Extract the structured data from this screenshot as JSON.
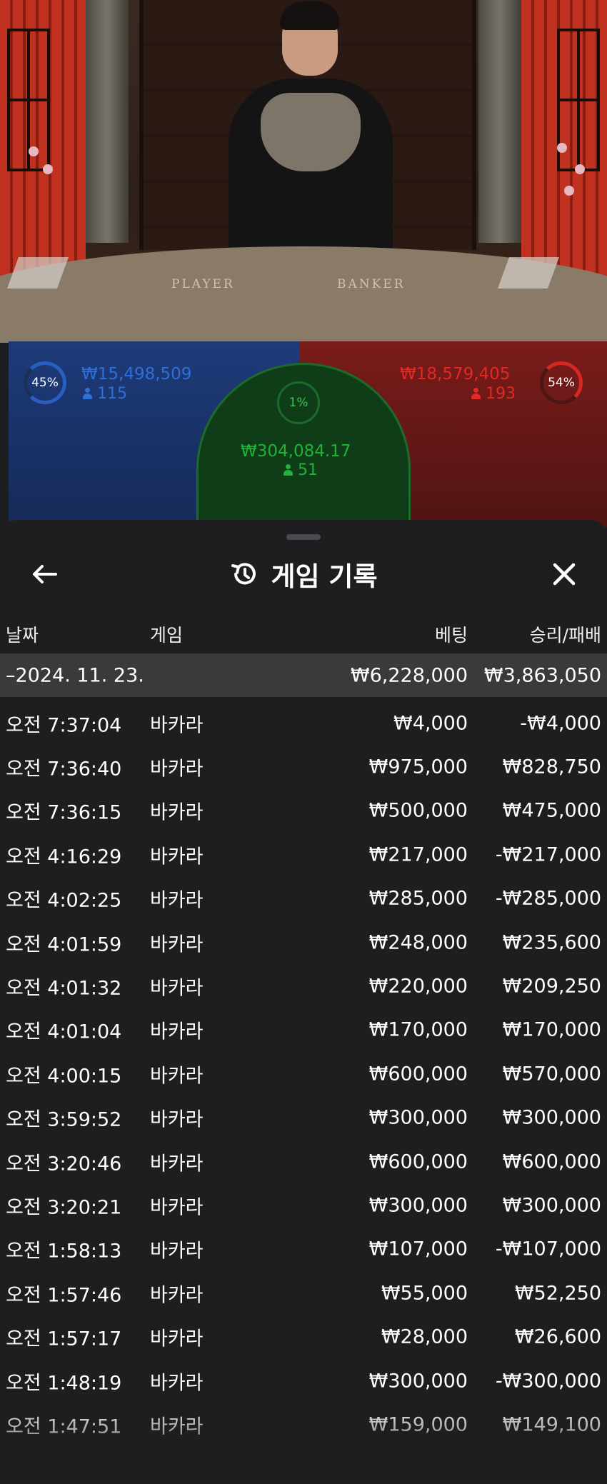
{
  "video": {
    "table_labels": {
      "player": "PLAYER",
      "banker": "BANKER"
    }
  },
  "bets": {
    "player": {
      "percent": "45%",
      "amount": "₩15,498,509",
      "count": "115",
      "color": "#2e6fd8"
    },
    "tie": {
      "percent": "1%",
      "amount": "₩304,084.17",
      "count": "51",
      "color": "#1fb33a"
    },
    "banker": {
      "percent": "54%",
      "amount": "₩18,579,405",
      "count": "193",
      "color": "#e02a22"
    }
  },
  "sheet": {
    "title": "게임 기록",
    "icons": {
      "back": "arrow-left-icon",
      "title": "history-icon",
      "close": "close-icon"
    },
    "columns": {
      "date": "날짜",
      "game": "게임",
      "bet": "베팅",
      "result": "승리/패배"
    },
    "date_group": {
      "date": "–2024. 11. 23.",
      "bet": "₩6,228,000",
      "result": "₩3,863,050"
    },
    "rows": [
      {
        "time": "오전 7:37:04",
        "game": "바카라",
        "bet": "₩4,000",
        "result": "-₩4,000"
      },
      {
        "time": "오전 7:36:40",
        "game": "바카라",
        "bet": "₩975,000",
        "result": "₩828,750"
      },
      {
        "time": "오전 7:36:15",
        "game": "바카라",
        "bet": "₩500,000",
        "result": "₩475,000"
      },
      {
        "time": "오전 4:16:29",
        "game": "바카라",
        "bet": "₩217,000",
        "result": "-₩217,000"
      },
      {
        "time": "오전 4:02:25",
        "game": "바카라",
        "bet": "₩285,000",
        "result": "-₩285,000"
      },
      {
        "time": "오전 4:01:59",
        "game": "바카라",
        "bet": "₩248,000",
        "result": "₩235,600"
      },
      {
        "time": "오전 4:01:32",
        "game": "바카라",
        "bet": "₩220,000",
        "result": "₩209,250"
      },
      {
        "time": "오전 4:01:04",
        "game": "바카라",
        "bet": "₩170,000",
        "result": "₩170,000"
      },
      {
        "time": "오전 4:00:15",
        "game": "바카라",
        "bet": "₩600,000",
        "result": "₩570,000"
      },
      {
        "time": "오전 3:59:52",
        "game": "바카라",
        "bet": "₩300,000",
        "result": "₩300,000"
      },
      {
        "time": "오전 3:20:46",
        "game": "바카라",
        "bet": "₩600,000",
        "result": "₩600,000"
      },
      {
        "time": "오전 3:20:21",
        "game": "바카라",
        "bet": "₩300,000",
        "result": "₩300,000"
      },
      {
        "time": "오전 1:58:13",
        "game": "바카라",
        "bet": "₩107,000",
        "result": "-₩107,000"
      },
      {
        "time": "오전 1:57:46",
        "game": "바카라",
        "bet": "₩55,000",
        "result": "₩52,250"
      },
      {
        "time": "오전 1:57:17",
        "game": "바카라",
        "bet": "₩28,000",
        "result": "₩26,600"
      },
      {
        "time": "오전 1:48:19",
        "game": "바카라",
        "bet": "₩300,000",
        "result": "-₩300,000"
      },
      {
        "time": "오전 1:47:51",
        "game": "바카라",
        "bet": "₩159,000",
        "result": "₩149,100"
      }
    ]
  }
}
